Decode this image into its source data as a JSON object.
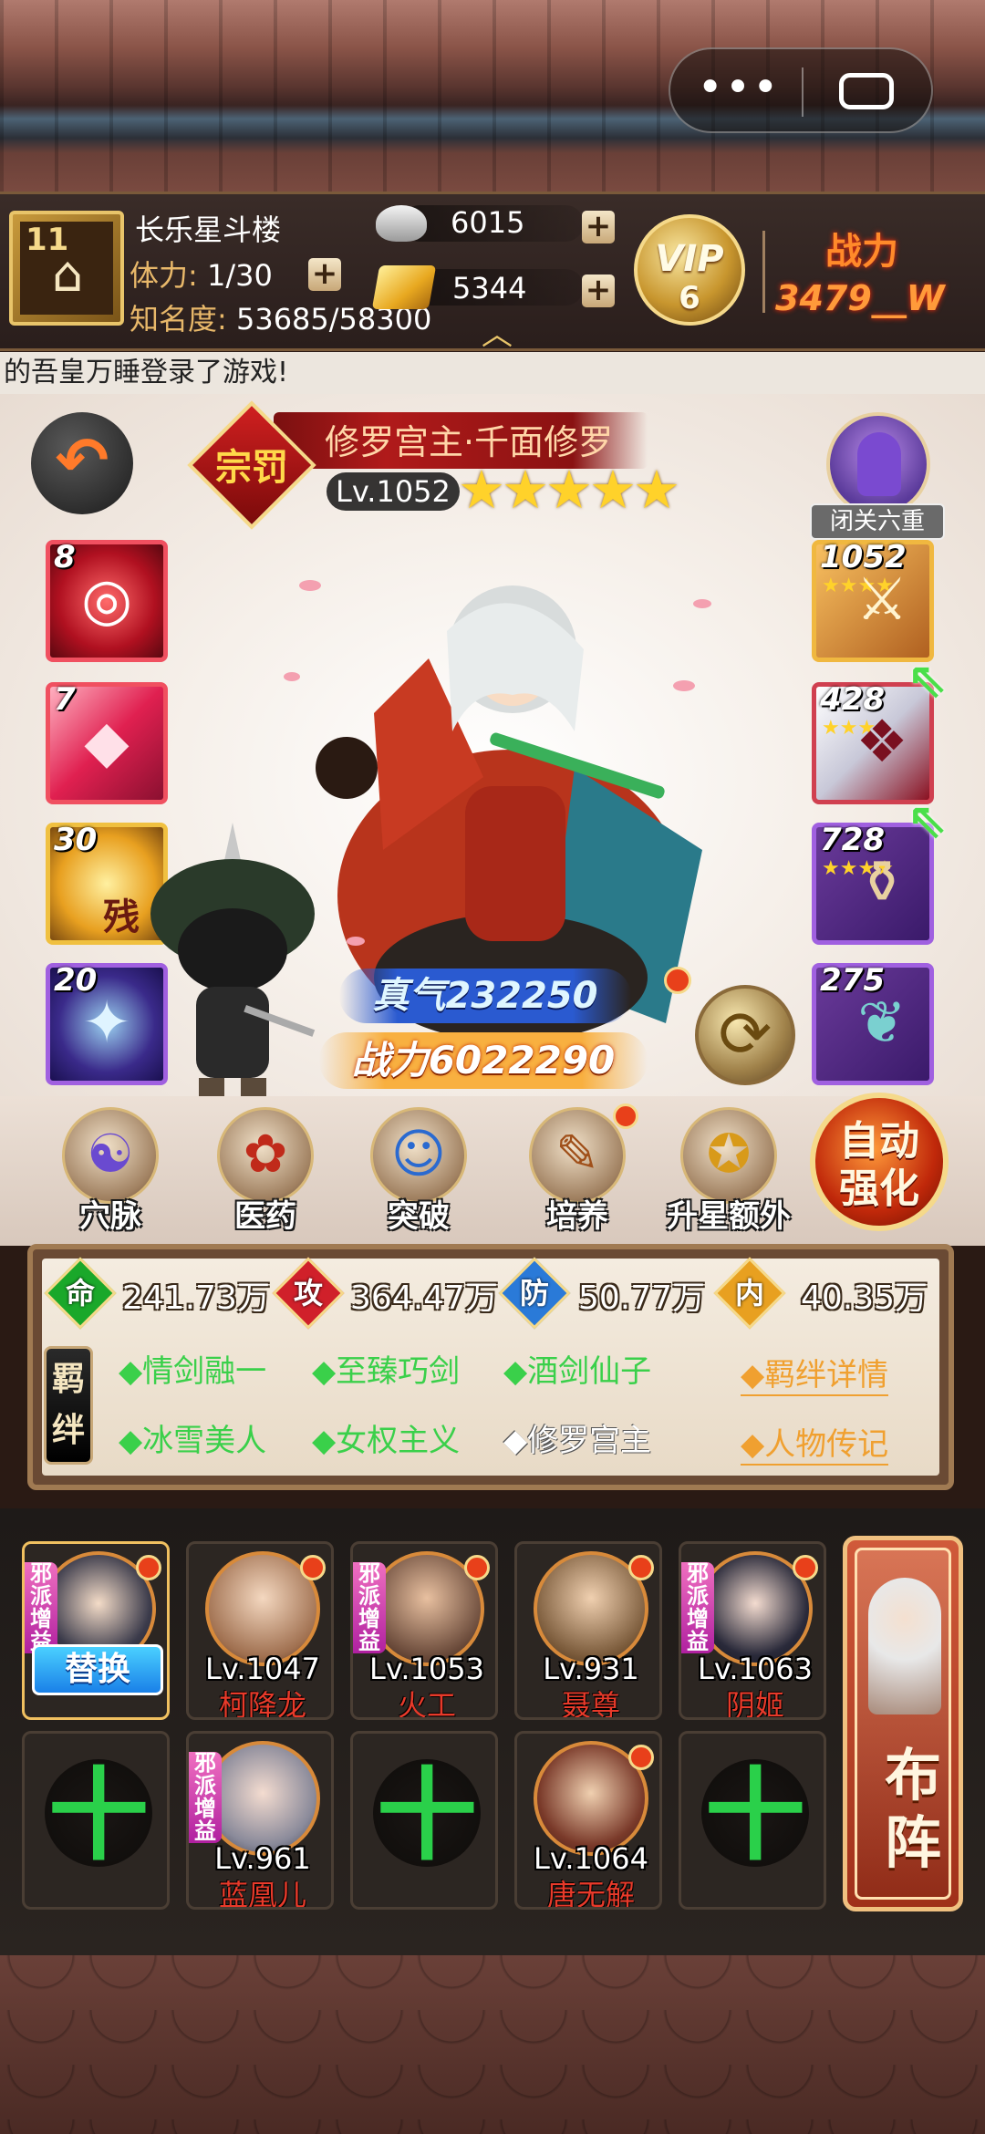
{
  "topbar": {
    "more_label": "•••",
    "game_icon": "gamepad-icon"
  },
  "header": {
    "avatar_level": "11",
    "player_name": "长乐星斗楼",
    "stamina_label": "体力:",
    "stamina_value": "1/30",
    "fame_label": "知名度:",
    "fame_value": "53685/58300",
    "silver": "6015",
    "gold": "5344",
    "plus": "+",
    "vip_label": "VIP",
    "vip_level": "6",
    "power_label": "战力",
    "power_value": "3479__W",
    "chevron": "︿"
  },
  "ticker": {
    "message": "的吾皇万睡登录了游戏!"
  },
  "hero": {
    "back_icon": "↶",
    "title": "修罗宫主·千面修罗",
    "seal_text": "宗罚",
    "level": "Lv.1052",
    "stars": "★★★★★",
    "seclusion_label": "闭关六重",
    "qi": "真气232250",
    "battle_power": "战力6022290",
    "refresh_icon": "⟳"
  },
  "left_slots": [
    {
      "num": "8",
      "glyph": "◎"
    },
    {
      "num": "7",
      "glyph": "◆"
    },
    {
      "num": "30",
      "glyph": "残"
    },
    {
      "num": "20",
      "glyph": "✦"
    }
  ],
  "right_slots": [
    {
      "num": "1052",
      "glyph": "⚔"
    },
    {
      "num": "428",
      "glyph": "❖"
    },
    {
      "num": "728",
      "glyph": "⚱"
    },
    {
      "num": "275",
      "glyph": "❦"
    }
  ],
  "actions": [
    {
      "label": "穴脉",
      "glyph": "☯"
    },
    {
      "label": "医药",
      "glyph": "✿"
    },
    {
      "label": "突破",
      "glyph": "☺"
    },
    {
      "label": "培养",
      "glyph": "✎"
    },
    {
      "label": "升星额外",
      "glyph": "✪"
    }
  ],
  "auto_button": {
    "line1": "自动",
    "line2": "强化"
  },
  "stats": [
    {
      "glyph": "命",
      "value": "241.73万",
      "color": "#1aa82a"
    },
    {
      "glyph": "攻",
      "value": "364.47万",
      "color": "#d0202a"
    },
    {
      "glyph": "防",
      "value": "50.77万",
      "color": "#2a7ad8"
    },
    {
      "glyph": "内",
      "value": "40.35万",
      "color": "#e8a020"
    }
  ],
  "bonds": {
    "tag": "羁绊",
    "row1": [
      "情剑融一",
      "至臻巧剑",
      "酒剑仙子"
    ],
    "row2": [
      "冰雪美人",
      "女权主义"
    ],
    "inactive": "修罗宫主",
    "detail_link": "羁绊详情",
    "bio_link": "人物传记",
    "diamond": "◆"
  },
  "team": {
    "replace_label": "替换",
    "evil_tag": "邪派增益",
    "empty_plus": "十",
    "members": [
      {
        "level": "Lv.1047",
        "name": "柯降龙"
      },
      {
        "level": "Lv.1053",
        "name": "火工"
      },
      {
        "level": "Lv.931",
        "name": "聂尊"
      },
      {
        "level": "Lv.1063",
        "name": "阴姬"
      },
      {
        "level": "Lv.961",
        "name": "蓝凰儿"
      },
      {
        "level": "Lv.1064",
        "name": "唐无解"
      }
    ],
    "formation_label": "布阵"
  }
}
